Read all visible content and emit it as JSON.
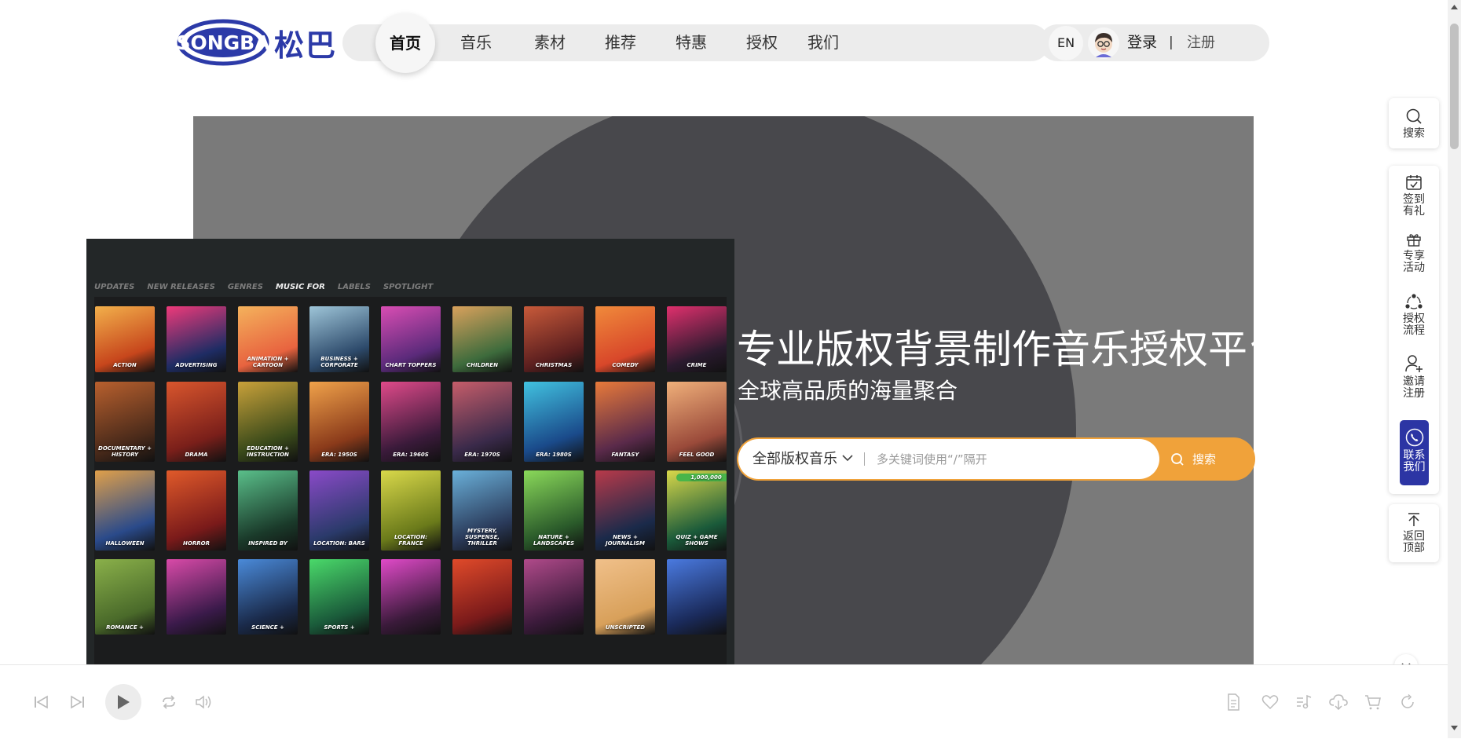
{
  "brand": {
    "logo_text": "SONGBA",
    "logo_cn": "松巴"
  },
  "nav": {
    "items": [
      {
        "label": "首页",
        "active": true
      },
      {
        "label": "音乐"
      },
      {
        "label": "素材"
      },
      {
        "label": "推荐"
      },
      {
        "label": "特惠"
      },
      {
        "label": "授权"
      },
      {
        "label": "我们"
      }
    ]
  },
  "user": {
    "lang": "EN",
    "login": "登录",
    "separator": "|",
    "register": "注册"
  },
  "hero": {
    "title": "专业版权背景制作音乐授权平台",
    "subtitle": "全球高品质的海量聚合"
  },
  "search": {
    "scope": "全部版权音乐",
    "placeholder": "多关键词使用“/”隔开",
    "button": "搜索"
  },
  "poster": {
    "tabs": [
      {
        "label": "UPDATES"
      },
      {
        "label": "NEW RELEASES"
      },
      {
        "label": "GENRES"
      },
      {
        "label": "MUSIC FOR",
        "active": true
      },
      {
        "label": "LABELS"
      },
      {
        "label": "SPOTLIGHT"
      }
    ],
    "rows": [
      [
        "ACTION",
        "ADVERTISING",
        "ANIMATION + CARTOON",
        "BUSINESS + CORPORATE",
        "CHART TOPPERS",
        "CHILDREN",
        "CHRISTMAS",
        "COMEDY",
        "CRIME"
      ],
      [
        "DOCUMENTARY + HISTORY",
        "DRAMA",
        "EDUCATION + INSTRUCTION",
        "ERA: 1950S",
        "ERA: 1960S",
        "ERA: 1970S",
        "ERA: 1980S",
        "FANTASY",
        "FEEL GOOD"
      ],
      [
        "HALLOWEEN",
        "HORROR",
        "INSPIRED BY",
        "LOCATION: BARS",
        "LOCATION: FRANCE",
        "MYSTERY, SUSPENSE, THRILLER",
        "NATURE + LANDSCAPES",
        "NEWS + JOURNALISM",
        "QUIZ + GAME SHOWS"
      ],
      [
        "ROMANCE +",
        "",
        "SCIENCE +",
        "SPORTS +",
        "",
        "",
        "",
        "UNSCRIPTED",
        ""
      ]
    ],
    "badge": "1,000,000"
  },
  "sidebar": {
    "search": "搜索",
    "checkin": "签到有礼",
    "events": "专享活动",
    "license_flow": "授权流程",
    "invite": "邀请注册",
    "contact": "联系我们",
    "top": "返回顶部"
  },
  "colors": {
    "accent": "#f0a23a",
    "brand_blue": "#2c35a4",
    "hero_gray": "#7a7a7a",
    "disc": "#48484c"
  }
}
